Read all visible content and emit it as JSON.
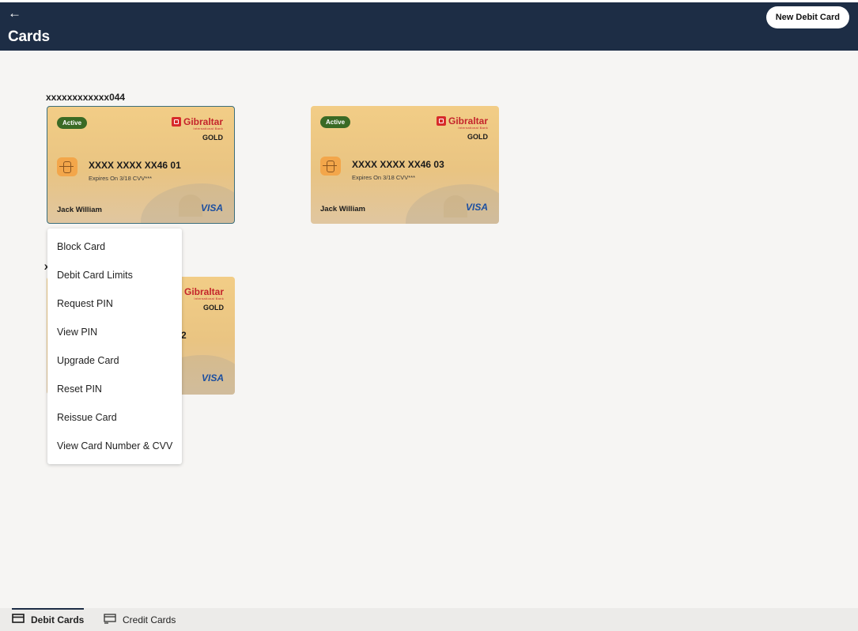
{
  "header": {
    "back_icon": "arrow-left-icon",
    "back_glyph": "←",
    "title": "Cards",
    "new_card_button": "New Debit Card"
  },
  "accounts": [
    {
      "label": "xxxxxxxxxxxx044",
      "cards": [
        {
          "status": "Active",
          "brand": "Gibraltar",
          "brand_sub": "International Bank",
          "tier": "GOLD",
          "number": "XXXX XXXX XX46 01",
          "expiry": "Expires On 3/18   CVV***",
          "holder": "Jack William",
          "network": "VISA"
        },
        {
          "status": "Active",
          "brand": "Gibraltar",
          "brand_sub": "International Bank",
          "tier": "GOLD",
          "number": "XXXX XXXX XX46 03",
          "expiry": "Expires On 3/18   CVV***",
          "holder": "Jack William",
          "network": "VISA"
        }
      ]
    },
    {
      "label": "x",
      "cards": [
        {
          "brand": "Gibraltar",
          "brand_sub": "International Bank",
          "tier": "GOLD",
          "number_tail": "2",
          "network": "VISA"
        }
      ]
    }
  ],
  "context_menu": {
    "items": [
      "Block Card",
      "Debit Card Limits",
      "Request PIN",
      "View PIN",
      "Upgrade Card",
      "Reset PIN",
      "Reissue Card",
      "View Card Number & CVV"
    ]
  },
  "tabs": [
    {
      "label": "Debit Cards",
      "icon": "debit-card-icon",
      "active": true
    },
    {
      "label": "Credit Cards",
      "icon": "credit-card-icon",
      "active": false
    }
  ],
  "colors": {
    "header_bg": "#1d2d45",
    "badge_active": "#3a6a25",
    "brand_red": "#c4242b",
    "visa_blue": "#1c4fa0"
  }
}
